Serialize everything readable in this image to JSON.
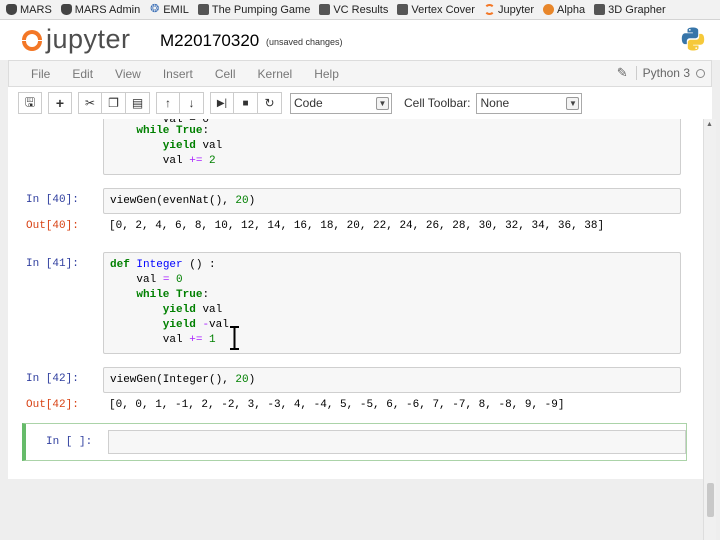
{
  "bookmarks": [
    {
      "label": "MARS",
      "icon": "mars-icon"
    },
    {
      "label": "MARS Admin",
      "icon": "mars-icon"
    },
    {
      "label": "EMIL",
      "icon": "emil-icon"
    },
    {
      "label": "The Pumping Game",
      "icon": "doc-icon"
    },
    {
      "label": "VC Results",
      "icon": "doc-icon"
    },
    {
      "label": "Vertex Cover",
      "icon": "doc-icon"
    },
    {
      "label": "Jupyter",
      "icon": "jupyter-icon"
    },
    {
      "label": "Alpha",
      "icon": "alpha-icon"
    },
    {
      "label": "3D Grapher",
      "icon": "graph-icon"
    }
  ],
  "header": {
    "logo_text": "jupyter",
    "notebook_name": "M220170320",
    "status": "(unsaved changes)"
  },
  "menu": [
    "File",
    "Edit",
    "View",
    "Insert",
    "Cell",
    "Kernel",
    "Help"
  ],
  "kernel": {
    "name": "Python 3"
  },
  "toolbar": {
    "cell_type": "Code",
    "cell_toolbar_label": "Cell Toolbar:",
    "cell_toolbar_value": "None"
  },
  "cells": {
    "c39": {
      "lines": [
        "    while True:",
        "        yield val",
        "        val += 2"
      ]
    },
    "c40": {
      "prompt_in": "In [40]:",
      "code": "viewGen(evenNat(), 20)",
      "prompt_out": "Out[40]:",
      "output": "[0, 2, 4, 6, 8, 10, 12, 14, 16, 18, 20, 22, 24, 26, 28, 30, 32, 34, 36, 38]"
    },
    "c41": {
      "prompt_in": "In [41]:",
      "lines": [
        "def Integer () :",
        "    val = 0",
        "    while True:",
        "        yield val",
        "        yield -val",
        "        val += 1"
      ]
    },
    "c42": {
      "prompt_in": "In [42]:",
      "code": "viewGen(Integer(), 20)",
      "prompt_out": "Out[42]:",
      "output": "[0, 0, 1, -1, 2, -2, 3, -3, 4, -4, 5, -5, 6, -6, 7, -7, 8, -8, 9, -9]"
    },
    "active": {
      "prompt_in": "In [ ]:"
    }
  },
  "colors": {
    "prompt_in": "#303f9f",
    "prompt_out": "#d84315",
    "active_border": "#66bb6a",
    "jupyter_orange": "#f37726"
  }
}
